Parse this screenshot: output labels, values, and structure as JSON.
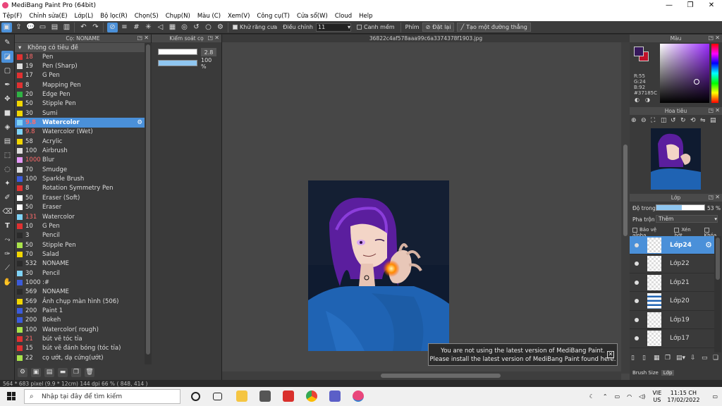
{
  "window": {
    "title": "MediBang Paint Pro (64bit)",
    "controls": [
      "—",
      "❐",
      "✕"
    ]
  },
  "menu": [
    "Tệp(F)",
    "Chỉnh sửa(E)",
    "Lớp(L)",
    "Bộ lọc(R)",
    "Chọn(S)",
    "Chụp(N)",
    "Màu (C)",
    "Xem(V)",
    "Công cụ(T)",
    "Cửa sổ(W)",
    "Cloud",
    "Help"
  ],
  "toolbar": {
    "antialias_label": "Khử răng cưa",
    "adjust_label": "Điều chỉnh",
    "adjust_value": "11",
    "soften_label": "Canh mềm",
    "key_label": "Phím",
    "reset_label": "Đặt lại",
    "straight_line_label": "Tạo một đường thẳng"
  },
  "brush_panel": {
    "title": "Cọ: NONAME",
    "group": "Không có tiêu đề",
    "items": [
      {
        "size": "18",
        "name": "Pen",
        "color": "#e03131",
        "size_color": "#ff6b6b"
      },
      {
        "size": "19",
        "name": "Pen (Sharp)",
        "color": "#dddddd"
      },
      {
        "size": "17",
        "name": "G Pen",
        "color": "#e03131"
      },
      {
        "size": "8",
        "name": "Mapping Pen",
        "color": "#e03131"
      },
      {
        "size": "20",
        "name": "Edge Pen",
        "color": "#2fb344"
      },
      {
        "size": "50",
        "name": "Stipple Pen",
        "color": "#f2d600"
      },
      {
        "size": "30",
        "name": "Sumi",
        "color": "#f2d600"
      },
      {
        "size": "9.8",
        "name": "Watercolor",
        "color": "#7fd3f7",
        "size_color": "#ff6b6b",
        "selected": true
      },
      {
        "size": "9.8",
        "name": "Watercolor (Wet)",
        "color": "#7fd3f7",
        "size_color": "#ff6b6b"
      },
      {
        "size": "58",
        "name": "Acrylic",
        "color": "#f2d600"
      },
      {
        "size": "100",
        "name": "Airbrush",
        "color": "#dddddd"
      },
      {
        "size": "1000",
        "name": "Blur",
        "color": "#e599f7",
        "size_color": "#ff6b6b"
      },
      {
        "size": "70",
        "name": "Smudge",
        "color": "#dddddd"
      },
      {
        "size": "100",
        "name": "Sparkle Brush",
        "color": "#3b5bdb"
      },
      {
        "size": "8",
        "name": "Rotation Symmetry Pen",
        "color": "#e03131"
      },
      {
        "size": "50",
        "name": "Eraser (Soft)",
        "color": "#ffffff"
      },
      {
        "size": "50",
        "name": "Eraser",
        "color": "#ffffff"
      },
      {
        "size": "131",
        "name": "Watercolor",
        "color": "#7fd3f7",
        "size_color": "#ff6b6b"
      },
      {
        "size": "10",
        "name": "G Pen",
        "color": "#e03131"
      },
      {
        "size": "3",
        "name": "Pencil",
        "color": "#2b2b2b"
      },
      {
        "size": "50",
        "name": "Stipple Pen",
        "color": "#a9e34b"
      },
      {
        "size": "70",
        "name": "Salad",
        "color": "#f2d600"
      },
      {
        "size": "532",
        "name": "NONAME",
        "color": "#2b2b2b"
      },
      {
        "size": "30",
        "name": "Pencil",
        "color": "#7fd3f7"
      },
      {
        "size": "1000",
        "name": ":#",
        "color": "#3b5bdb"
      },
      {
        "size": "569",
        "name": "NONAME",
        "color": "#2b2b2b"
      },
      {
        "size": "569",
        "name": "Ảnh chụp màn hình (506)",
        "color": "#f2d600"
      },
      {
        "size": "200",
        "name": "Paint 1",
        "color": "#3b5bdb"
      },
      {
        "size": "200",
        "name": "Bokeh",
        "color": "#3b5bdb"
      },
      {
        "size": "100",
        "name": "Watercolor( rough)",
        "color": "#a9e34b"
      },
      {
        "size": "21",
        "name": "bút vẽ tóc tỉa",
        "color": "#e03131",
        "size_color": "#ff6b6b"
      },
      {
        "size": "15",
        "name": "bút vẽ đánh bóng (tóc tỉa)",
        "color": "#e03131"
      },
      {
        "size": "22",
        "name": "cọ ướt, dạ cứng(ướt)",
        "color": "#a9e34b"
      }
    ]
  },
  "control_panel": {
    "title": "Kiểm soát cọ",
    "size_value": "2.8",
    "opacity_value": "100 %",
    "opacity_fraction": 1.0,
    "size_fraction": 0.95
  },
  "canvas": {
    "tab_title": "36822c4af578aaa99c6a3374378f1903.jpg"
  },
  "notification": {
    "line1": "You are not using the latest version of MediBang Paint.",
    "line2": "Please install the latest version of MediBang Paint found here."
  },
  "color_panel": {
    "title": "Màu",
    "r": "R:55",
    "g": "G:24",
    "b": "B:92",
    "hex": "#37185C",
    "fg_color": "#37185c",
    "bg_color": "#c0102a"
  },
  "navigator": {
    "title": "Hoa tiêu"
  },
  "layer_panel": {
    "title": "Lớp",
    "opacity_label": "Độ trong",
    "opacity_value": "53 %",
    "opacity_fraction": 0.53,
    "blend_label": "Pha trộn",
    "blend_value": "Thêm",
    "protect_alpha": "Bảo vệ alpha",
    "clipping": "Xén bớt",
    "lock": "Khóa",
    "layers": [
      {
        "name": "Lớp24",
        "selected": true
      },
      {
        "name": "Lớp22"
      },
      {
        "name": "Lớp21"
      },
      {
        "name": "Lớp20"
      },
      {
        "name": "Lớp19"
      },
      {
        "name": "Lớp17"
      }
    ],
    "footer_tabs": [
      "Brush Size",
      "Lớp"
    ]
  },
  "status": "564 * 683 pixel   (9.9 * 12cm)   144 dpi   66 %   ( 848, 414 )",
  "taskbar": {
    "search_placeholder": "Nhập tại đây để tìm kiếm",
    "lang1": "VIE",
    "lang2": "US",
    "time": "11:15 CH",
    "date": "17/02/2022"
  }
}
